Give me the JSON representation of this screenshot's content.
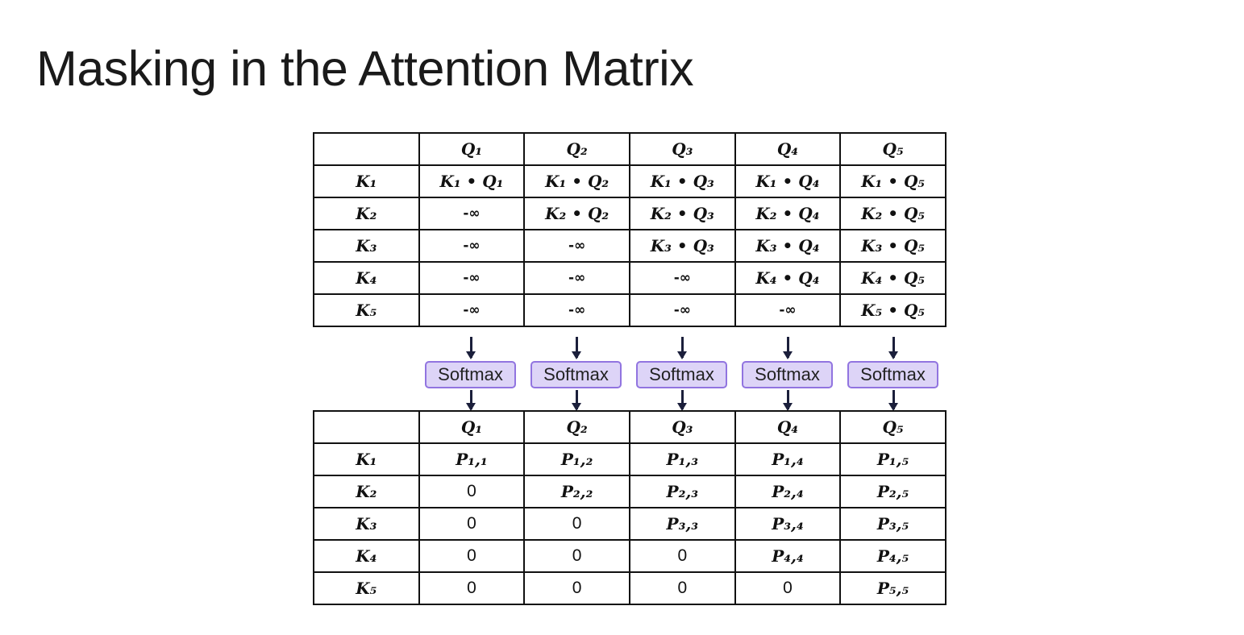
{
  "title": "Masking in the Attention Matrix",
  "scores_table": {
    "header": [
      "",
      "Q₁",
      "Q₂",
      "Q₃",
      "Q₄",
      "Q₅"
    ],
    "rows": [
      [
        "K₁",
        "K₁ • Q₁",
        "K₁ • Q₂",
        "K₁ • Q₃",
        "K₁ • Q₄",
        "K₁ • Q₅"
      ],
      [
        "K₂",
        "-∞",
        "K₂ • Q₂",
        "K₂ • Q₃",
        "K₂ • Q₄",
        "K₂ • Q₅"
      ],
      [
        "K₃",
        "-∞",
        "-∞",
        "K₃ • Q₃",
        "K₃ • Q₄",
        "K₃ • Q₅"
      ],
      [
        "K₄",
        "-∞",
        "-∞",
        "-∞",
        "K₄ • Q₄",
        "K₄ • Q₅"
      ],
      [
        "K₅",
        "-∞",
        "-∞",
        "-∞",
        "-∞",
        "K₅ • Q₅"
      ]
    ]
  },
  "softmax_labels": [
    "Softmax",
    "Softmax",
    "Softmax",
    "Softmax",
    "Softmax"
  ],
  "probabilities_table": {
    "header": [
      "",
      "Q₁",
      "Q₂",
      "Q₃",
      "Q₄",
      "Q₅"
    ],
    "rows": [
      [
        "K₁",
        "P₁,₁",
        "P₁,₂",
        "P₁,₃",
        "P₁,₄",
        "P₁,₅"
      ],
      [
        "K₂",
        "0",
        "P₂,₂",
        "P₂,₃",
        "P₂,₄",
        "P₂,₅"
      ],
      [
        "K₃",
        "0",
        "0",
        "P₃,₃",
        "P₃,₄",
        "P₃,₅"
      ],
      [
        "K₄",
        "0",
        "0",
        "0",
        "P₄,₄",
        "P₄,₅"
      ],
      [
        "K₅",
        "0",
        "0",
        "0",
        "0",
        "P₅,₅"
      ]
    ]
  },
  "colors": {
    "softmax_fill": "#ddd4f7",
    "softmax_border": "#9174e0",
    "arrow": "#1b1f3b",
    "grid_line": "#111111"
  }
}
